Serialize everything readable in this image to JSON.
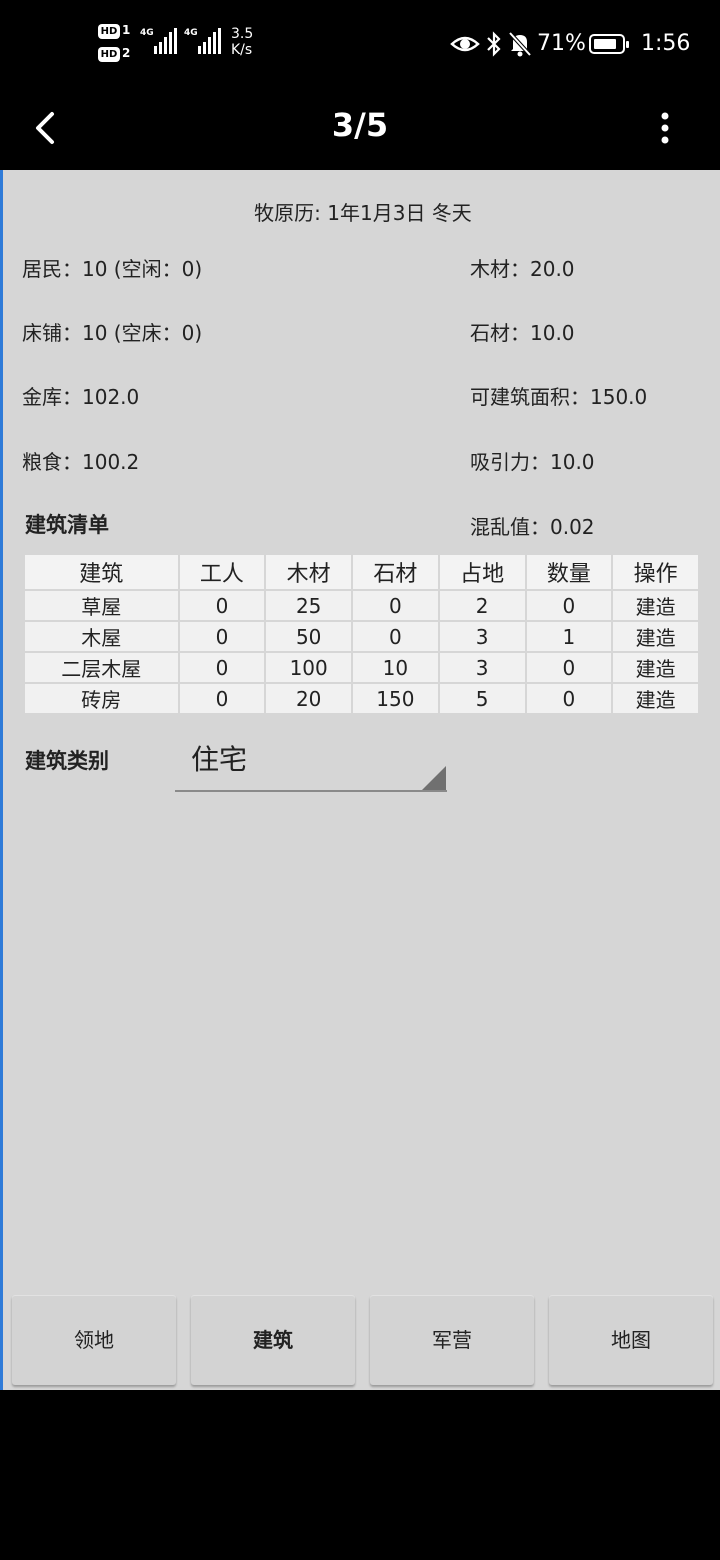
{
  "status_bar": {
    "sim1": "1",
    "sim2": "2",
    "hd": "HD",
    "net_type": "4G",
    "speed_value": "3.5",
    "speed_unit": "K/s",
    "battery_percent": "71%",
    "time": "1:56"
  },
  "header": {
    "title": "3/5"
  },
  "main": {
    "date": "牧原历: 1年1月3日  冬天",
    "stats_left": [
      "居民：10 (空闲：0)",
      "床铺：10 (空床：0)",
      "金库：102.0",
      "粮食：100.2"
    ],
    "stats_right": [
      "木材：20.0",
      "石材：10.0",
      "可建筑面积：150.0",
      "吸引力：10.0",
      "混乱值：0.02"
    ],
    "list_heading": "建筑清单",
    "table": {
      "columns": [
        "建筑",
        "工人",
        "木材",
        "石材",
        "占地",
        "数量",
        "操作"
      ],
      "rows": [
        [
          "草屋",
          "0",
          "25",
          "0",
          "2",
          "0",
          "建造"
        ],
        [
          "木屋",
          "0",
          "50",
          "0",
          "3",
          "1",
          "建造"
        ],
        [
          "二层木屋",
          "0",
          "100",
          "10",
          "3",
          "0",
          "建造"
        ],
        [
          "砖房",
          "0",
          "20",
          "150",
          "5",
          "0",
          "建造"
        ]
      ]
    },
    "category_label": "建筑类别",
    "category_value": "住宅"
  },
  "bottom_tabs": [
    "领地",
    "建筑",
    "军营",
    "地图"
  ],
  "colors": {
    "content_bg": "#d6d6d6",
    "left_accent": "#2f7bd8"
  }
}
